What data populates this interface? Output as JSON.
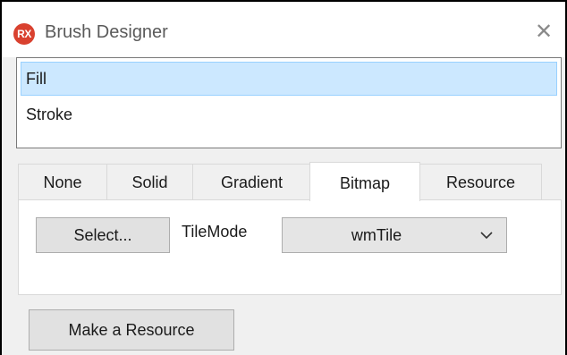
{
  "window": {
    "title": "Brush Designer",
    "icon_text": "RX",
    "close_glyph": "✕"
  },
  "brush_targets": {
    "items": [
      {
        "label": "Fill",
        "selected": true
      },
      {
        "label": "Stroke",
        "selected": false
      }
    ]
  },
  "tabs": {
    "items": [
      {
        "label": "None",
        "active": false
      },
      {
        "label": "Solid",
        "active": false
      },
      {
        "label": "Gradient",
        "active": false
      },
      {
        "label": "Bitmap",
        "active": true
      },
      {
        "label": "Resource",
        "active": false
      }
    ]
  },
  "bitmap_panel": {
    "select_label": "Select...",
    "tilemode_label": "TileMode",
    "tilemode_value": "wmTile"
  },
  "footer": {
    "make_resource_label": "Make a Resource"
  },
  "colors": {
    "app_icon": "#d9412f",
    "selection_bg": "#cce8ff",
    "selection_border": "#99d1ff",
    "button_bg": "#e1e1e1"
  }
}
